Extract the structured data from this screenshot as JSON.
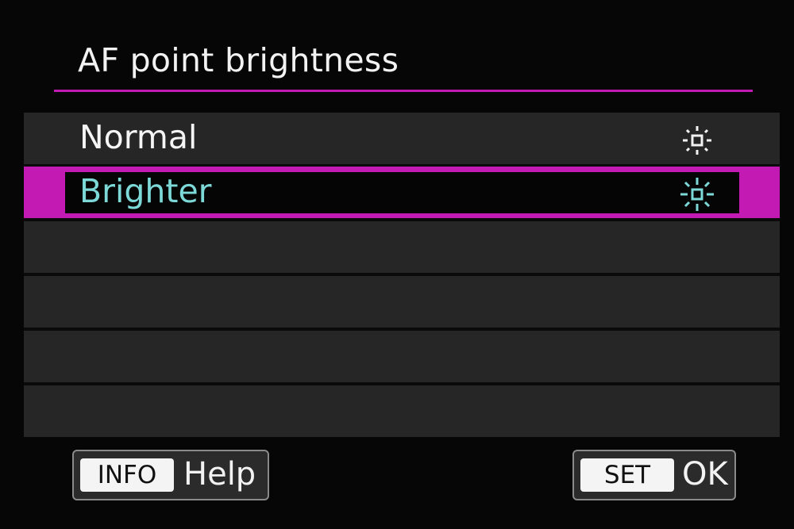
{
  "screen": {
    "title": "AF point brightness",
    "accent_color": "#c21ab2",
    "selected_text_color": "#7dd8d8"
  },
  "menu": {
    "options": [
      {
        "label": "Normal",
        "icon": "af-point-normal-icon",
        "selected": false
      },
      {
        "label": "Brighter",
        "icon": "af-point-bright-icon",
        "selected": true
      }
    ],
    "empty_rows": 4
  },
  "footer": {
    "help_key": "INFO",
    "help_label": "Help",
    "ok_key": "SET",
    "ok_label": "OK"
  }
}
